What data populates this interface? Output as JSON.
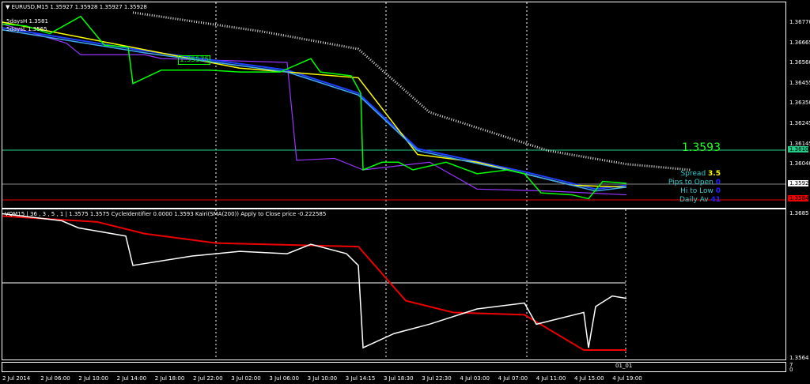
{
  "header": {
    "symbol": "EURUSD,M15",
    "ohlc": "1.35927 1.35928 1.35927 1.35928",
    "line1": "5daysH 1.3581",
    "line2": "5daysL 1.3565",
    "marker_label": "1.35575"
  },
  "info": {
    "price": "1.3593",
    "spread_label": "Spread",
    "spread": "3.5",
    "pips_label": "Pips to Open",
    "pips": "0",
    "hilo_label": "Hi to Low",
    "hilo": "0",
    "daily_label": "Daily Av",
    "daily": "41"
  },
  "price_axis": {
    "ticks": [
      "1.36770",
      "1.36665",
      "1.36560",
      "1.36455",
      "1.36350",
      "1.36245",
      "1.36145",
      "1.36040"
    ],
    "tag_green": "1.36101",
    "tag_white": "1.35928",
    "tag_red": "1.35846"
  },
  "indicator": {
    "title": "VQM15 | 36 , 3 , 5 , 1  |  1.3575 1.3575  CycleIdentifier 0.0000 1.3593  Kairi(SMA(200)) Apply to Close price -0.222585",
    "top": "1.3685",
    "bottom": "1.3564",
    "mini_label": "01_01",
    "mini_scale": "7\n0"
  },
  "time_axis": [
    "2 Jul 2014",
    "2 Jul 06:00",
    "2 Jul 10:00",
    "2 Jul 14:00",
    "2 Jul 18:00",
    "2 Jul 22:00",
    "3 Jul 02:00",
    "3 Jul 06:00",
    "3 Jul 10:00",
    "3 Jul 14:15",
    "3 Jul 18:30",
    "3 Jul 22:30",
    "4 Jul 03:00",
    "4 Jul 07:00",
    "4 Jul 11:00",
    "4 Jul 15:00",
    "4 Jul 19:00"
  ],
  "colors": {
    "price": "#00ff00",
    "ma_yellow": "#ffff00",
    "ma_blue": "#1e40ff",
    "ma_sky": "#3fa9f5",
    "red": "#e00000",
    "purple": "#9933ff",
    "ind_line": "#ffffff"
  },
  "chart_data": {
    "type": "line",
    "title": "EURUSD,M15",
    "ylim": [
      1.3583,
      1.3688
    ],
    "x_unit": "bar",
    "close": [
      [
        0,
        1.3676
      ],
      [
        10,
        1.3675
      ],
      [
        20,
        1.3671
      ],
      [
        33,
        1.368
      ],
      [
        43,
        1.3665
      ],
      [
        53,
        1.3664
      ],
      [
        55,
        1.3645
      ],
      [
        67,
        1.3652
      ],
      [
        87,
        1.3652
      ],
      [
        100,
        1.3651
      ],
      [
        117,
        1.3651
      ],
      [
        130,
        1.3658
      ],
      [
        134,
        1.3651
      ],
      [
        147,
        1.3649
      ],
      [
        151,
        1.364
      ],
      [
        152,
        1.36
      ],
      [
        160,
        1.3604
      ],
      [
        167,
        1.3604
      ],
      [
        173,
        1.36
      ],
      [
        187,
        1.3604
      ],
      [
        200,
        1.3598
      ],
      [
        213,
        1.36
      ],
      [
        220,
        1.3598
      ],
      [
        227,
        1.3588
      ],
      [
        240,
        1.3587
      ],
      [
        247,
        1.3585
      ],
      [
        253,
        1.3594
      ],
      [
        263,
        1.3593
      ]
    ],
    "ma_yellow": [
      [
        0,
        1.3677
      ],
      [
        50,
        1.3665
      ],
      [
        100,
        1.3653
      ],
      [
        150,
        1.3648
      ],
      [
        175,
        1.3608
      ],
      [
        200,
        1.3604
      ],
      [
        240,
        1.3592
      ],
      [
        263,
        1.3591
      ]
    ],
    "ma_blue": [
      [
        0,
        1.3674
      ],
      [
        60,
        1.3662
      ],
      [
        120,
        1.3652
      ],
      [
        150,
        1.364
      ],
      [
        175,
        1.3611
      ],
      [
        220,
        1.3599
      ],
      [
        250,
        1.359
      ],
      [
        263,
        1.3592
      ]
    ],
    "purple": [
      [
        0,
        1.3676
      ],
      [
        27,
        1.3666
      ],
      [
        33,
        1.366
      ],
      [
        60,
        1.366
      ],
      [
        67,
        1.3658
      ],
      [
        120,
        1.3656
      ],
      [
        124,
        1.3605
      ],
      [
        140,
        1.3606
      ],
      [
        152,
        1.36
      ],
      [
        180,
        1.3604
      ],
      [
        200,
        1.359
      ],
      [
        230,
        1.3589
      ],
      [
        263,
        1.3587
      ]
    ],
    "indicator": {
      "ylim": [
        1.3564,
        1.3685
      ],
      "price": [
        [
          0,
          1.3684
        ],
        [
          25,
          1.3678
        ],
        [
          32,
          1.3672
        ],
        [
          52,
          1.3665
        ],
        [
          55,
          1.364
        ],
        [
          80,
          1.3648
        ],
        [
          100,
          1.3652
        ],
        [
          120,
          1.365
        ],
        [
          130,
          1.3658
        ],
        [
          145,
          1.365
        ],
        [
          150,
          1.364
        ],
        [
          152,
          1.357
        ],
        [
          165,
          1.3582
        ],
        [
          180,
          1.359
        ],
        [
          200,
          1.3603
        ],
        [
          220,
          1.3608
        ],
        [
          225,
          1.359
        ],
        [
          245,
          1.36
        ],
        [
          247,
          1.357
        ],
        [
          250,
          1.3605
        ],
        [
          257,
          1.3614
        ],
        [
          263,
          1.3612
        ]
      ],
      "signal": [
        [
          0,
          1.3682
        ],
        [
          40,
          1.3677
        ],
        [
          60,
          1.3667
        ],
        [
          90,
          1.3659
        ],
        [
          150,
          1.3656
        ],
        [
          170,
          1.361
        ],
        [
          190,
          1.36
        ],
        [
          220,
          1.3598
        ],
        [
          245,
          1.3568
        ],
        [
          263,
          1.3568
        ]
      ]
    }
  }
}
